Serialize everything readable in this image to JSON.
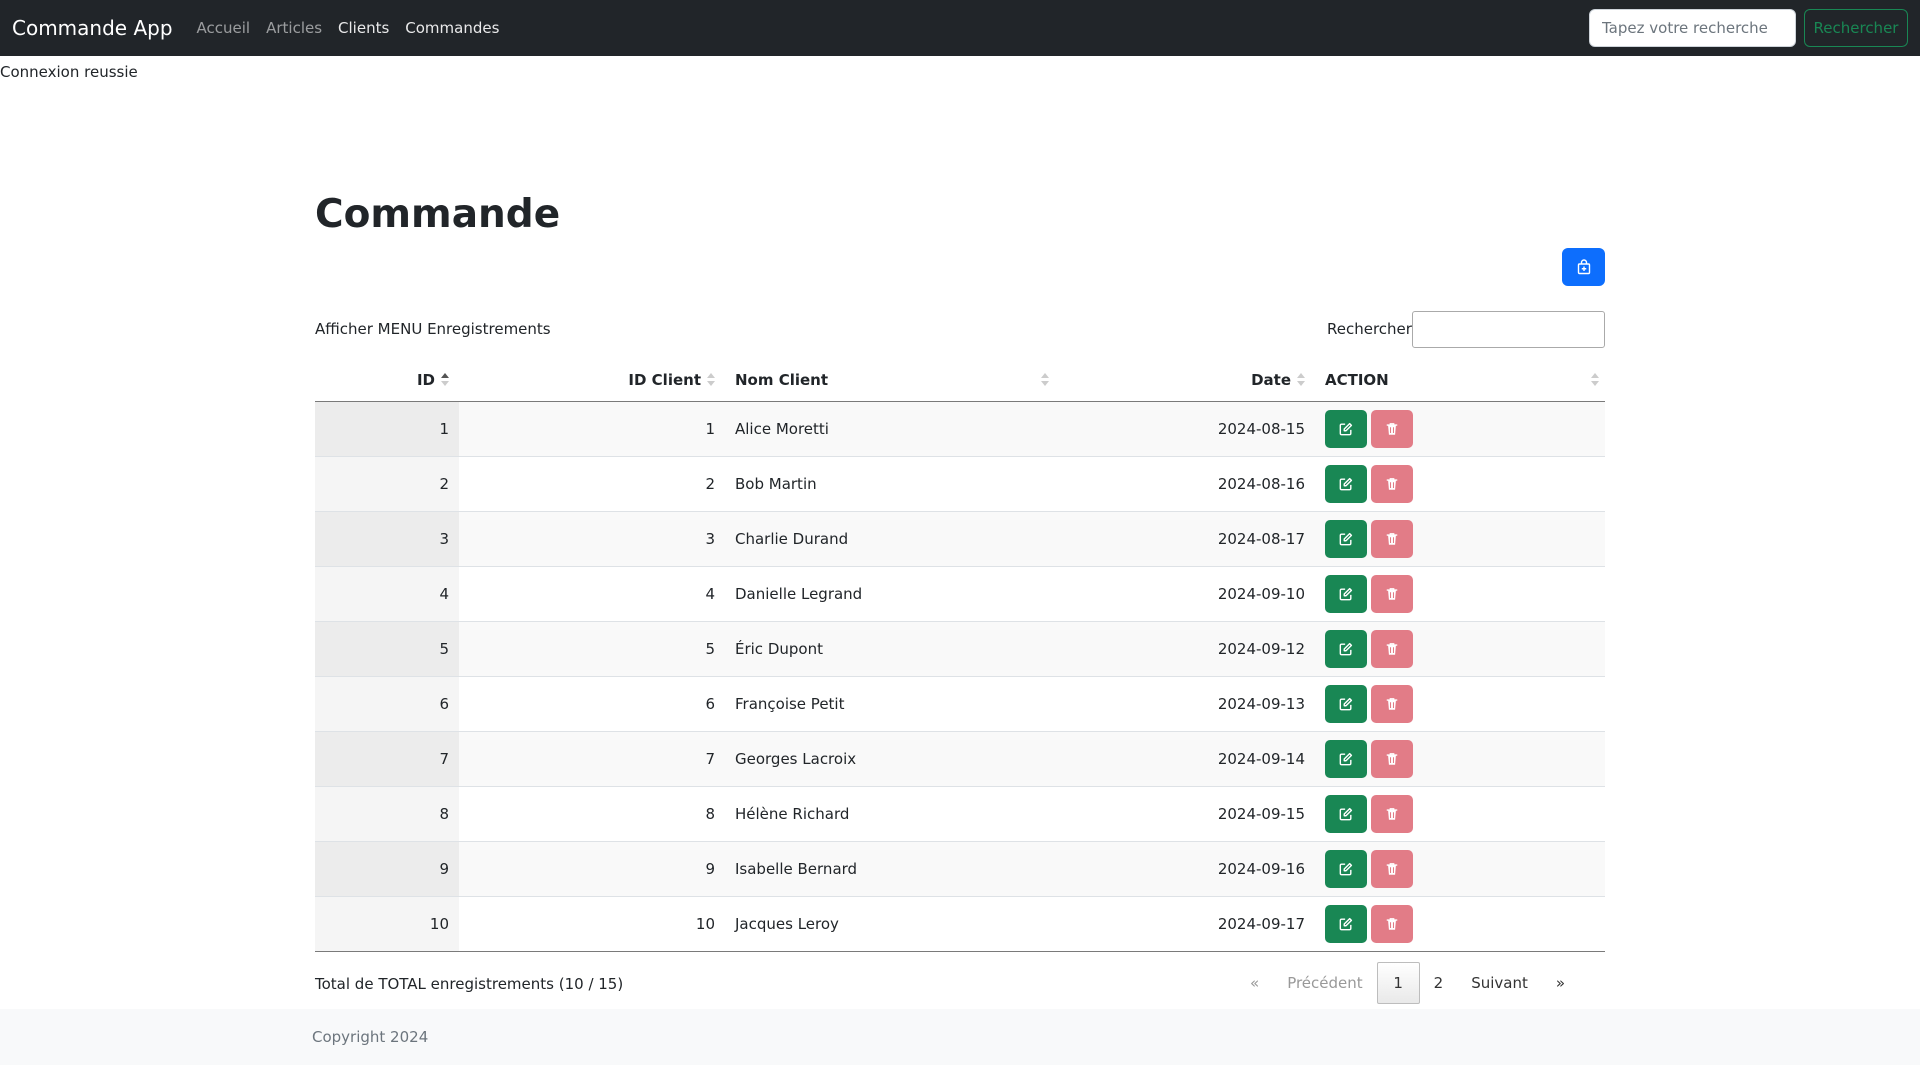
{
  "navbar": {
    "brand": "Commande App",
    "links": [
      "Accueil",
      "Articles",
      "Clients",
      "Commandes"
    ],
    "search_placeholder": "Tapez votre recherche",
    "search_button": "Rechercher"
  },
  "flash_message": "Connexion reussie",
  "page_title": "Commande",
  "add_button_icon": "bag-plus-icon",
  "table_controls": {
    "length_label": "Afficher MENU Enregistrements",
    "search_label": "Rechercher:"
  },
  "table": {
    "columns": [
      "ID",
      "ID Client",
      "Nom Client",
      "Date",
      "ACTION"
    ],
    "rows": [
      {
        "id": "1",
        "client_id": "1",
        "name": "Alice Moretti",
        "date": "2024-08-15"
      },
      {
        "id": "2",
        "client_id": "2",
        "name": "Bob Martin",
        "date": "2024-08-16"
      },
      {
        "id": "3",
        "client_id": "3",
        "name": "Charlie Durand",
        "date": "2024-08-17"
      },
      {
        "id": "4",
        "client_id": "4",
        "name": "Danielle Legrand",
        "date": "2024-09-10"
      },
      {
        "id": "5",
        "client_id": "5",
        "name": "Éric Dupont",
        "date": "2024-09-12"
      },
      {
        "id": "6",
        "client_id": "6",
        "name": "Françoise Petit",
        "date": "2024-09-13"
      },
      {
        "id": "7",
        "client_id": "7",
        "name": "Georges Lacroix",
        "date": "2024-09-14"
      },
      {
        "id": "8",
        "client_id": "8",
        "name": "Hélène Richard",
        "date": "2024-09-15"
      },
      {
        "id": "9",
        "client_id": "9",
        "name": "Isabelle Bernard",
        "date": "2024-09-16"
      },
      {
        "id": "10",
        "client_id": "10",
        "name": "Jacques Leroy",
        "date": "2024-09-17"
      }
    ],
    "row_action_icons": [
      "edit-icon",
      "trash-icon"
    ]
  },
  "table_info": "Total de TOTAL enregistrements (10 / 15)",
  "pagination": {
    "first": "«",
    "previous": "Précédent",
    "pages": [
      "1",
      "2"
    ],
    "current_page": "1",
    "next": "Suivant",
    "last": "»"
  },
  "footer": {
    "text": "Copyright 2024"
  },
  "colors": {
    "navbar_bg": "#212529",
    "primary": "#0d6efd",
    "success": "#198754",
    "danger_soft": "#e27c87",
    "footer_bg": "#f8f9fa"
  }
}
